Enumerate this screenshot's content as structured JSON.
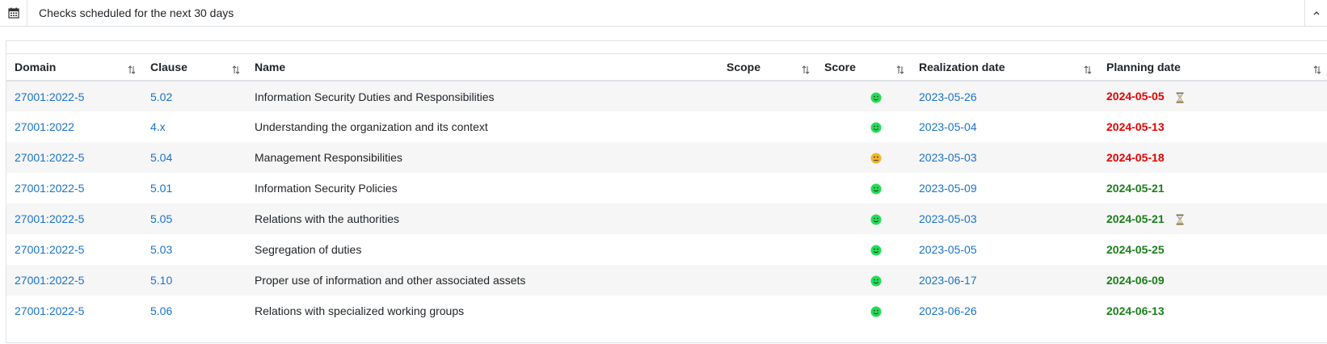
{
  "panel": {
    "title": "Checks scheduled for the next 30 days",
    "icon": "calendar-icon",
    "collapse_icon": "chevron-up-icon"
  },
  "table": {
    "columns": [
      "Domain",
      "Clause",
      "Name",
      "Scope",
      "Score",
      "Realization date",
      "Planning date"
    ],
    "rows": [
      {
        "domain": "27001:2022-5",
        "clause": "5.02",
        "name": "Information Security Duties and Responsibilities",
        "scope": "",
        "score": "green",
        "realization": "2023-05-26",
        "planning": "2024-05-05",
        "overdue": true,
        "hourglass": true
      },
      {
        "domain": "27001:2022",
        "clause": "4.x",
        "name": "Understanding the organization and its context",
        "scope": "",
        "score": "green",
        "realization": "2023-05-04",
        "planning": "2024-05-13",
        "overdue": true,
        "hourglass": false
      },
      {
        "domain": "27001:2022-5",
        "clause": "5.04",
        "name": "Management Responsibilities",
        "scope": "",
        "score": "orange",
        "realization": "2023-05-03",
        "planning": "2024-05-18",
        "overdue": true,
        "hourglass": false
      },
      {
        "domain": "27001:2022-5",
        "clause": "5.01",
        "name": "Information Security Policies",
        "scope": "",
        "score": "green",
        "realization": "2023-05-09",
        "planning": "2024-05-21",
        "overdue": false,
        "hourglass": false
      },
      {
        "domain": "27001:2022-5",
        "clause": "5.05",
        "name": "Relations with the authorities",
        "scope": "",
        "score": "green",
        "realization": "2023-05-03",
        "planning": "2024-05-21",
        "overdue": false,
        "hourglass": true
      },
      {
        "domain": "27001:2022-5",
        "clause": "5.03",
        "name": "Segregation of duties",
        "scope": "",
        "score": "green",
        "realization": "2023-05-05",
        "planning": "2024-05-25",
        "overdue": false,
        "hourglass": false
      },
      {
        "domain": "27001:2022-5",
        "clause": "5.10",
        "name": "Proper use of information and other associated assets",
        "scope": "",
        "score": "green",
        "realization": "2023-06-17",
        "planning": "2024-06-09",
        "overdue": false,
        "hourglass": false
      },
      {
        "domain": "27001:2022-5",
        "clause": "5.06",
        "name": "Relations with specialized working groups",
        "scope": "",
        "score": "green",
        "realization": "2023-06-26",
        "planning": "2024-06-13",
        "overdue": false,
        "hourglass": false
      }
    ]
  },
  "colors": {
    "link": "#1a73c8",
    "overdue": "#e60000",
    "upcoming": "#1a7f1a",
    "score_green": "#22dd55",
    "score_orange": "#f0b429"
  }
}
